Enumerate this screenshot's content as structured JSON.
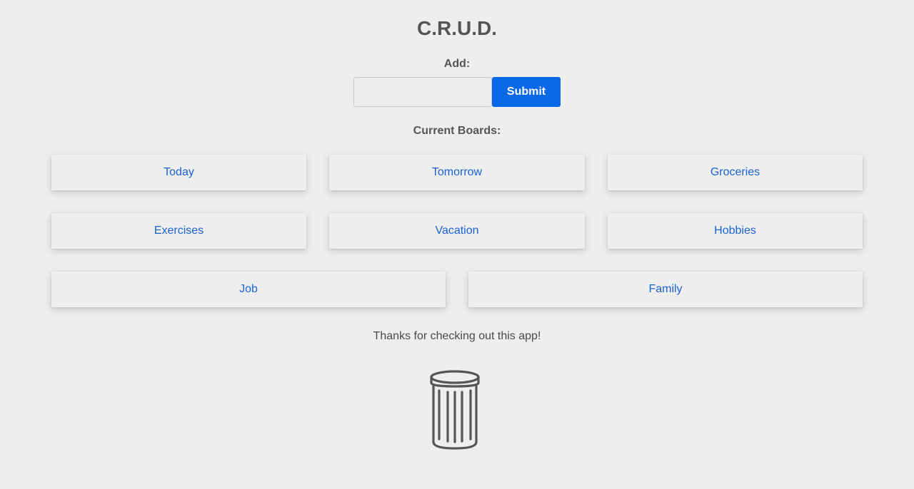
{
  "header": {
    "title": "C.R.U.D."
  },
  "add_form": {
    "label": "Add:",
    "input_value": "",
    "placeholder": "",
    "submit_label": "Submit",
    "accent_color": "#0868e8"
  },
  "boards": {
    "label": "Current Boards:",
    "items": [
      {
        "label": "Today"
      },
      {
        "label": "Tomorrow"
      },
      {
        "label": "Groceries"
      },
      {
        "label": "Exercises"
      },
      {
        "label": "Vacation"
      },
      {
        "label": "Hobbies"
      },
      {
        "label": "Job"
      },
      {
        "label": "Family"
      }
    ],
    "link_color": "#1a62d6"
  },
  "footer": {
    "message": "Thanks for checking out this app!",
    "trash_icon": "trash-can-icon"
  }
}
